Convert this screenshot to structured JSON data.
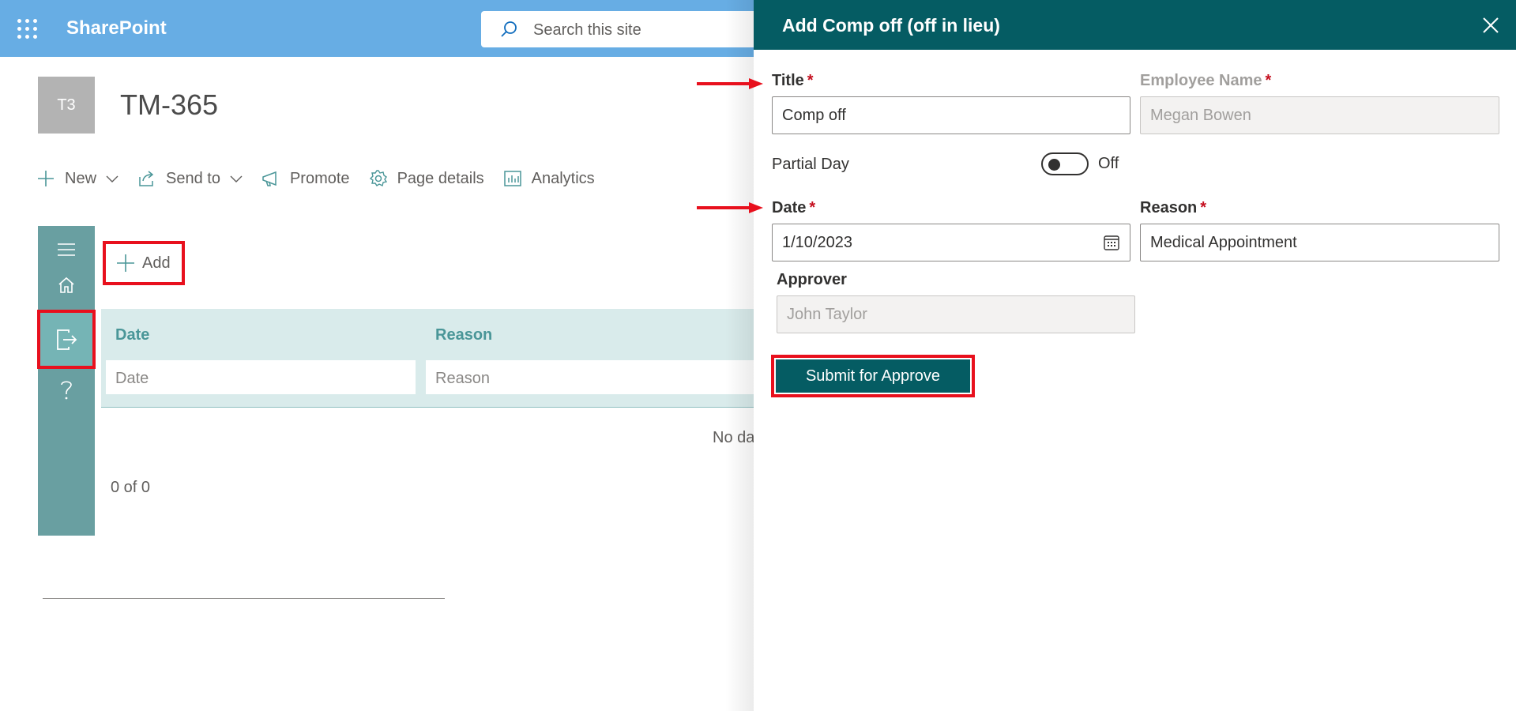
{
  "suitebar": {
    "brand": "SharePoint",
    "search_placeholder": "Search this site"
  },
  "site": {
    "logo_text": "T3",
    "title": "TM-365"
  },
  "commands": {
    "new": "New",
    "send_to": "Send to",
    "promote": "Promote",
    "page_details": "Page details",
    "analytics": "Analytics"
  },
  "list": {
    "add_label": "Add",
    "columns": [
      "Date",
      "Reason"
    ],
    "filter_placeholders": [
      "Date",
      "Reason"
    ],
    "empty_text": "No da",
    "pager": "0 of 0"
  },
  "panel": {
    "title": "Add Comp off (off in lieu)",
    "title_label": "Title",
    "title_value": "Comp off",
    "employee_label": "Employee Name",
    "employee_value": "Megan Bowen",
    "partial_day_label": "Partial Day",
    "partial_day_state": "Off",
    "date_label": "Date",
    "date_value": "1/10/2023",
    "reason_label": "Reason",
    "reason_value": "Medical Appointment",
    "approver_label": "Approver",
    "approver_value": "John Taylor",
    "submit_label": "Submit for Approve",
    "required_mark": "*"
  },
  "colors": {
    "suitebar": "#67ade4",
    "panel_header": "#055c63",
    "nav": "#699fa1",
    "highlight": "#e8101d"
  }
}
